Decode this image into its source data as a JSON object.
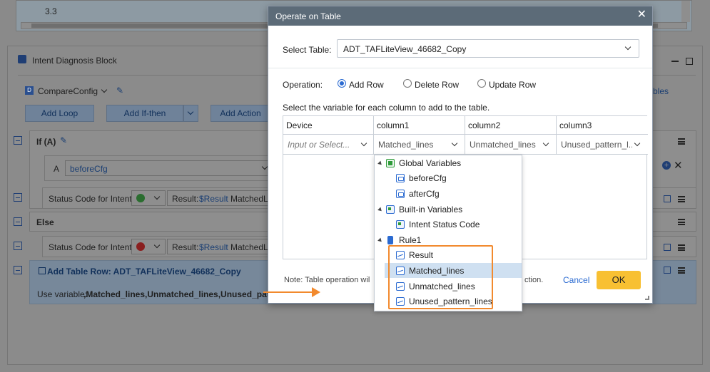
{
  "background": {
    "top_value": "3.3",
    "block_title": "Intent Diagnosis Block",
    "config_name": "CompareConfig",
    "tables_label": "bles",
    "buttons": {
      "add_loop": "Add Loop",
      "add_if_then": "Add If-then",
      "add_action": "Add Action"
    },
    "if_label": "If (A)",
    "condition_letter": "A",
    "condition_value": "beforeCfg",
    "status_code_label": "Status Code for Intent:",
    "result_label": "Result:",
    "result_var": "$Result",
    "result_rest_1": "MatchedLi",
    "result_rest_2": "MatchedLi",
    "else_label": "Else",
    "add_table_row": "Add Table Row: ADT_TAFLiteView_46682_Copy",
    "use_variable_label": "Use variable:",
    "use_variable_value": ",Matched_lines,Unmatched_lines,Unused_patte..."
  },
  "modal": {
    "title": "Operate on Table",
    "select_table_label": "Select Table:",
    "select_table_value": "ADT_TAFLiteView_46682_Copy",
    "operation_label": "Operation:",
    "operations": [
      "Add Row",
      "Delete Row",
      "Update Row"
    ],
    "selected_operation": "Add Row",
    "instruction": "Select the variable for each column to add to the table.",
    "columns": [
      "Device",
      "column1",
      "column2",
      "column3"
    ],
    "column_values": [
      "Input or Select...",
      "Matched_lines",
      "Unmatched_lines",
      "Unused_pattern_l..."
    ],
    "note_start": "Note: Table operation wil",
    "note_end": "ction.",
    "cancel_label": "Cancel",
    "ok_label": "OK"
  },
  "dropdown": {
    "groups": [
      {
        "label": "Global Variables",
        "items": [
          "beforeCfg",
          "afterCfg"
        ]
      },
      {
        "label": "Built-in Variables",
        "items": [
          "Intent Status Code"
        ]
      },
      {
        "label": "Rule1",
        "items": [
          "Result",
          "Matched_lines",
          "Unmatched_lines",
          "Unused_pattern_lines"
        ]
      }
    ],
    "selected_item": "Matched_lines"
  },
  "colors": {
    "accent": "#2a6ad1",
    "ok_button": "#f8c032",
    "highlight": "#f28a2e",
    "header": "#5c6b78"
  }
}
